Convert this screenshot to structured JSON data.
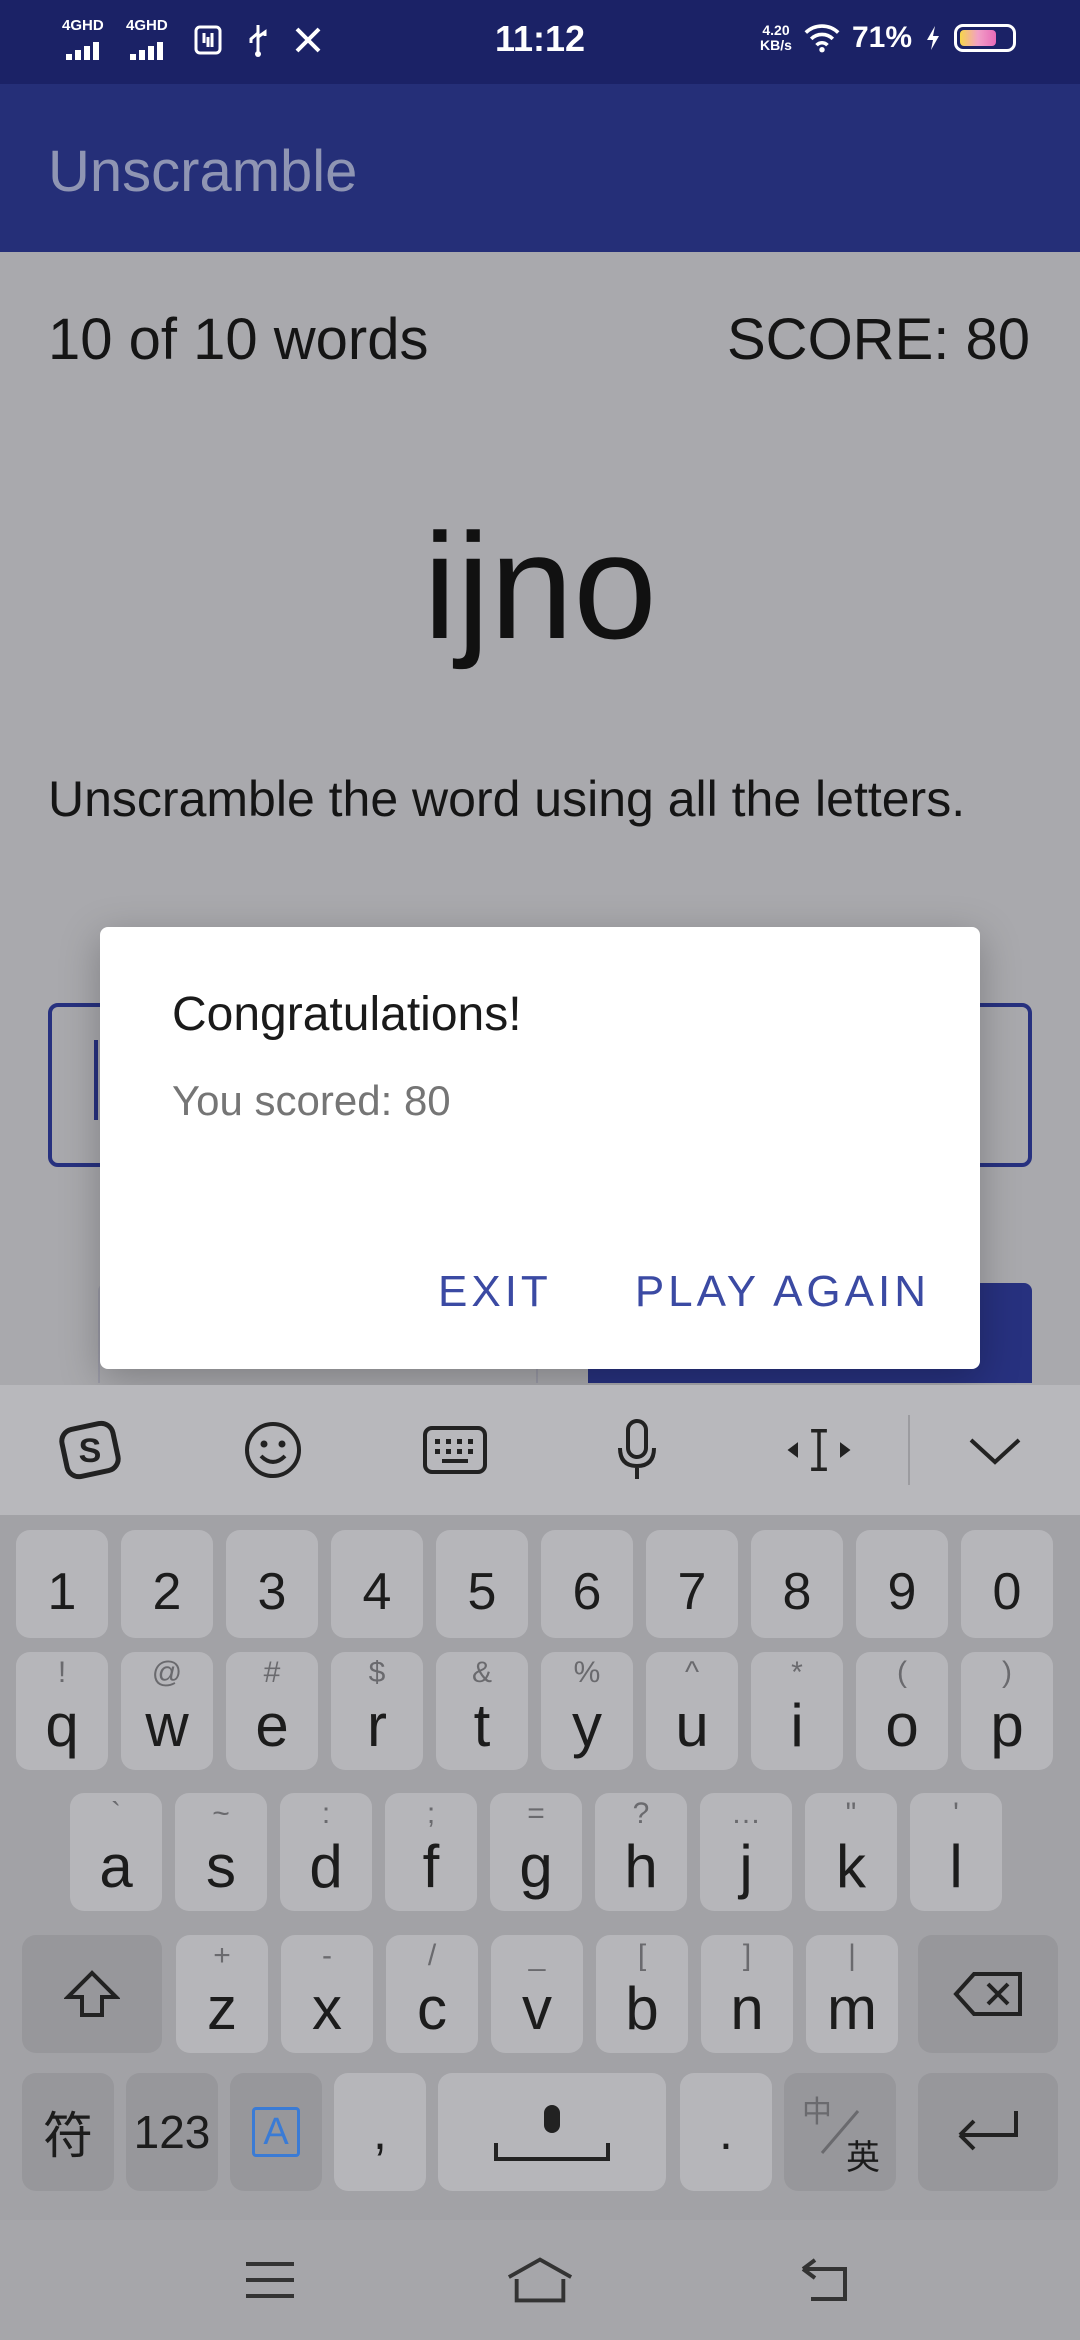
{
  "status_bar": {
    "signal1": "4GHD",
    "signal2": "4GHD",
    "time": "11:12",
    "speed_value": "4.20",
    "speed_unit": "KB/s",
    "battery_percent": "71%",
    "battery_level": 0.71
  },
  "app": {
    "title": "Unscramble"
  },
  "game": {
    "word_count": "10 of 10 words",
    "score": "SCORE: 80",
    "scrambled_word": "ijno",
    "instructions": "Unscramble the word using all the letters."
  },
  "dialog": {
    "title": "Congratulations!",
    "message": "You scored: 80",
    "exit_label": "EXIT",
    "play_again_label": "PLAY AGAIN"
  },
  "keyboard": {
    "number_row": [
      "1",
      "2",
      "3",
      "4",
      "5",
      "6",
      "7",
      "8",
      "9",
      "0"
    ],
    "row1": [
      {
        "k": "q",
        "s": "!"
      },
      {
        "k": "w",
        "s": "@"
      },
      {
        "k": "e",
        "s": "#"
      },
      {
        "k": "r",
        "s": "$"
      },
      {
        "k": "t",
        "s": "&"
      },
      {
        "k": "y",
        "s": "%"
      },
      {
        "k": "u",
        "s": "^"
      },
      {
        "k": "i",
        "s": "*"
      },
      {
        "k": "o",
        "s": "("
      },
      {
        "k": "p",
        "s": ")"
      }
    ],
    "row2": [
      {
        "k": "a",
        "s": "`"
      },
      {
        "k": "s",
        "s": "~"
      },
      {
        "k": "d",
        "s": ":"
      },
      {
        "k": "f",
        "s": ";"
      },
      {
        "k": "g",
        "s": "="
      },
      {
        "k": "h",
        "s": "?"
      },
      {
        "k": "j",
        "s": "…"
      },
      {
        "k": "k",
        "s": "\""
      },
      {
        "k": "l",
        "s": "'"
      }
    ],
    "row3": [
      {
        "k": "z",
        "s": "+"
      },
      {
        "k": "x",
        "s": "-"
      },
      {
        "k": "c",
        "s": "/"
      },
      {
        "k": "v",
        "s": "_"
      },
      {
        "k": "b",
        "s": "["
      },
      {
        "k": "n",
        "s": "]"
      },
      {
        "k": "m",
        "s": "|"
      }
    ],
    "symbols_label": "符",
    "numbers_label": "123",
    "lang_indicator": "A",
    "comma": ",",
    "period": ".",
    "lang_toggle_top": "中",
    "lang_toggle_bottom": "英"
  }
}
